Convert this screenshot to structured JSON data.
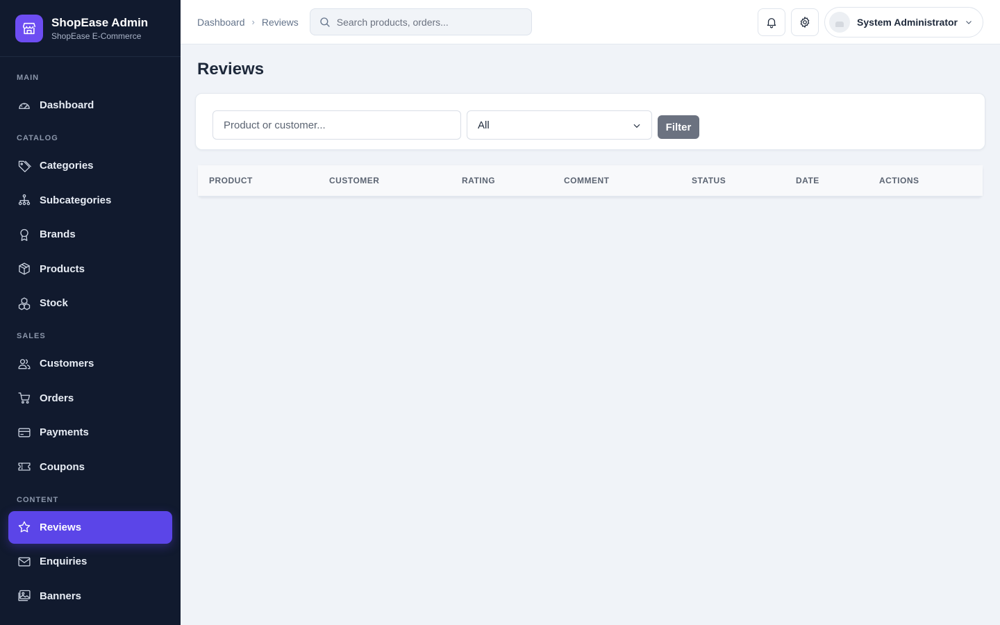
{
  "brand": {
    "title": "ShopEase Admin",
    "subtitle": "ShopEase E-Commerce",
    "logo_icon": "store-icon",
    "accent": "#6d4df2"
  },
  "sidebar": {
    "sections": [
      {
        "label": "MAIN",
        "items": [
          {
            "label": "Dashboard",
            "icon": "gauge-icon"
          }
        ]
      },
      {
        "label": "CATALOG",
        "items": [
          {
            "label": "Categories",
            "icon": "tag-icon"
          },
          {
            "label": "Subcategories",
            "icon": "hierarchy-icon"
          },
          {
            "label": "Brands",
            "icon": "award-icon"
          },
          {
            "label": "Products",
            "icon": "box-icon"
          },
          {
            "label": "Stock",
            "icon": "boxes-icon"
          }
        ]
      },
      {
        "label": "SALES",
        "items": [
          {
            "label": "Customers",
            "icon": "users-icon"
          },
          {
            "label": "Orders",
            "icon": "cart-icon"
          },
          {
            "label": "Payments",
            "icon": "card-icon"
          },
          {
            "label": "Coupons",
            "icon": "ticket-icon"
          }
        ]
      },
      {
        "label": "CONTENT",
        "items": [
          {
            "label": "Reviews",
            "icon": "star-icon",
            "active": true
          },
          {
            "label": "Enquiries",
            "icon": "envelope-icon"
          },
          {
            "label": "Banners",
            "icon": "image-icon"
          }
        ]
      }
    ],
    "active_color": "#5b45e8"
  },
  "header": {
    "breadcrumb": [
      "Dashboard",
      "Reviews"
    ],
    "search_placeholder": "Search products, orders...",
    "user_name": "System Administrator"
  },
  "page": {
    "title": "Reviews",
    "filter": {
      "input_placeholder": "Product or customer...",
      "select_value": "All",
      "button_label": "Filter"
    },
    "table": {
      "columns": [
        "PRODUCT",
        "CUSTOMER",
        "RATING",
        "COMMENT",
        "STATUS",
        "DATE",
        "ACTIONS"
      ]
    }
  }
}
